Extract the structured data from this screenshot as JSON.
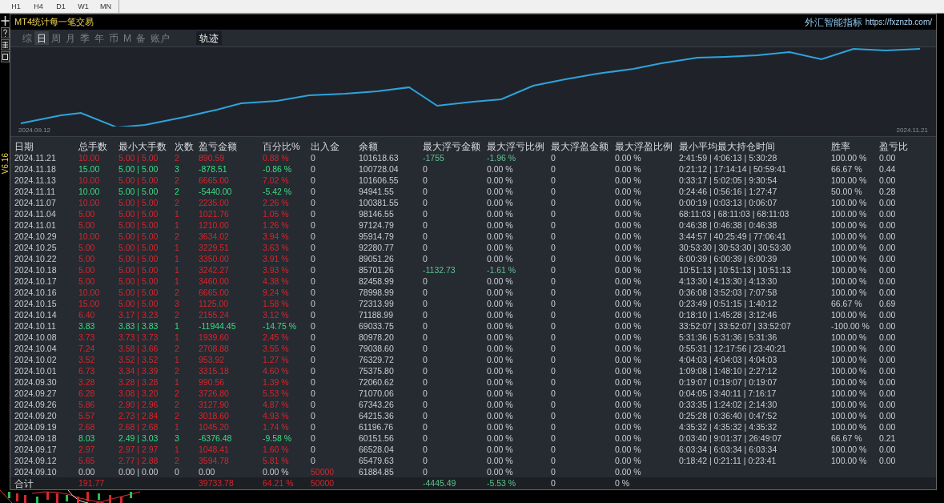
{
  "toolbar": {
    "timeframes": [
      "H1",
      "H4",
      "D1",
      "W1",
      "MN"
    ]
  },
  "sidebar": {
    "version": "V6.16"
  },
  "panel": {
    "title": "MT4统计每一笔交易",
    "brand": "外汇智能指标",
    "url": "https://fxznzb.com/"
  },
  "tabs": [
    {
      "label": "综",
      "selected": false
    },
    {
      "label": "日",
      "selected": true
    },
    {
      "label": "周",
      "selected": false
    },
    {
      "label": "月",
      "selected": false
    },
    {
      "label": "季",
      "selected": false
    },
    {
      "label": "年",
      "selected": false
    },
    {
      "label": "币",
      "selected": false
    },
    {
      "label": "M",
      "selected": false
    },
    {
      "label": "备",
      "selected": false
    },
    {
      "label": "账户",
      "selected": false
    }
  ],
  "track_button": {
    "label": "轨迹"
  },
  "chart": {
    "start_label": "2024.09.12",
    "end_label": "2024.11.21"
  },
  "table": {
    "columns": [
      "日期",
      "总手数",
      "最小大手数",
      "次数",
      "盈亏金额",
      "百分比%",
      "出入金",
      "余额",
      "最大浮亏金额",
      "最大浮亏比例",
      "最大浮盈金额",
      "最大浮盈比例",
      "最小平均最大持仓时间",
      "胜率",
      "盈亏比"
    ],
    "rows": [
      {
        "kind": "profit",
        "float_loss": true,
        "cells": [
          "2024.11.21",
          "10.00",
          "5.00 | 5.00",
          "2",
          "890.59",
          "0.88 %",
          "0",
          "101618.63",
          "-1755",
          "-1.96 %",
          "0",
          "0.00 %",
          "2:41:59 | 4:06:13 | 5:30:28",
          "100.00 %",
          "0.00"
        ]
      },
      {
        "kind": "loss",
        "float_loss": false,
        "cells": [
          "2024.11.18",
          "15.00",
          "5.00 | 5.00",
          "3",
          "-878.51",
          "-0.86 %",
          "0",
          "100728.04",
          "0",
          "0.00 %",
          "0",
          "0.00 %",
          "0:21:12 | 17:14:14 | 50:59:41",
          "66.67 %",
          "0.44"
        ]
      },
      {
        "kind": "profit",
        "float_loss": false,
        "cells": [
          "2024.11.13",
          "10.00",
          "5.00 | 5.00",
          "2",
          "6665.00",
          "7.02 %",
          "0",
          "101606.55",
          "0",
          "0.00 %",
          "0",
          "0.00 %",
          "0:33:17 | 5:02:05 | 9:30:54",
          "100.00 %",
          "0.00"
        ]
      },
      {
        "kind": "loss",
        "float_loss": false,
        "cells": [
          "2024.11.11",
          "10.00",
          "5.00 | 5.00",
          "2",
          "-5440.00",
          "-5.42 %",
          "0",
          "94941.55",
          "0",
          "0.00 %",
          "0",
          "0.00 %",
          "0:24:46 | 0:56:16 | 1:27:47",
          "50.00 %",
          "0.28"
        ]
      },
      {
        "kind": "profit",
        "float_loss": false,
        "cells": [
          "2024.11.07",
          "10.00",
          "5.00 | 5.00",
          "2",
          "2235.00",
          "2.26 %",
          "0",
          "100381.55",
          "0",
          "0.00 %",
          "0",
          "0.00 %",
          "0:00:19 | 0:03:13 | 0:06:07",
          "100.00 %",
          "0.00"
        ]
      },
      {
        "kind": "profit",
        "float_loss": false,
        "cells": [
          "2024.11.04",
          "5.00",
          "5.00 | 5.00",
          "1",
          "1021.76",
          "1.05 %",
          "0",
          "98146.55",
          "0",
          "0.00 %",
          "0",
          "0.00 %",
          "68:11:03 | 68:11:03 | 68:11:03",
          "100.00 %",
          "0.00"
        ]
      },
      {
        "kind": "profit",
        "float_loss": false,
        "cells": [
          "2024.11.01",
          "5.00",
          "5.00 | 5.00",
          "1",
          "1210.00",
          "1.26 %",
          "0",
          "97124.79",
          "0",
          "0.00 %",
          "0",
          "0.00 %",
          "0:46:38 | 0:46:38 | 0:46:38",
          "100.00 %",
          "0.00"
        ]
      },
      {
        "kind": "profit",
        "float_loss": false,
        "cells": [
          "2024.10.29",
          "10.00",
          "5.00 | 5.00",
          "2",
          "3634.02",
          "3.94 %",
          "0",
          "95914.79",
          "0",
          "0.00 %",
          "0",
          "0.00 %",
          "3:44:57 | 40:25:49 | 77:06:41",
          "100.00 %",
          "0.00"
        ]
      },
      {
        "kind": "profit",
        "float_loss": false,
        "cells": [
          "2024.10.25",
          "5.00",
          "5.00 | 5.00",
          "1",
          "3229.51",
          "3.63 %",
          "0",
          "92280.77",
          "0",
          "0.00 %",
          "0",
          "0.00 %",
          "30:53:30 | 30:53:30 | 30:53:30",
          "100.00 %",
          "0.00"
        ]
      },
      {
        "kind": "profit",
        "float_loss": false,
        "cells": [
          "2024.10.22",
          "5.00",
          "5.00 | 5.00",
          "1",
          "3350.00",
          "3.91 %",
          "0",
          "89051.26",
          "0",
          "0.00 %",
          "0",
          "0.00 %",
          "6:00:39 | 6:00:39 | 6:00:39",
          "100.00 %",
          "0.00"
        ]
      },
      {
        "kind": "profit",
        "float_loss": true,
        "cells": [
          "2024.10.18",
          "5.00",
          "5.00 | 5.00",
          "1",
          "3242.27",
          "3.93 %",
          "0",
          "85701.26",
          "-1132.73",
          "-1.61 %",
          "0",
          "0.00 %",
          "10:51:13 | 10:51:13 | 10:51:13",
          "100.00 %",
          "0.00"
        ]
      },
      {
        "kind": "profit",
        "float_loss": false,
        "cells": [
          "2024.10.17",
          "5.00",
          "5.00 | 5.00",
          "1",
          "3460.00",
          "4.38 %",
          "0",
          "82458.99",
          "0",
          "0.00 %",
          "0",
          "0.00 %",
          "4:13:30 | 4:13:30 | 4:13:30",
          "100.00 %",
          "0.00"
        ]
      },
      {
        "kind": "profit",
        "float_loss": false,
        "cells": [
          "2024.10.16",
          "10.00",
          "5.00 | 5.00",
          "2",
          "6665.00",
          "9.24 %",
          "0",
          "78998.99",
          "0",
          "0.00 %",
          "0",
          "0.00 %",
          "0:36:08 | 3:52:03 | 7:07:58",
          "100.00 %",
          "0.00"
        ]
      },
      {
        "kind": "profit",
        "float_loss": false,
        "cells": [
          "2024.10.15",
          "15.00",
          "5.00 | 5.00",
          "3",
          "1125.00",
          "1.58 %",
          "0",
          "72313.99",
          "0",
          "0.00 %",
          "0",
          "0.00 %",
          "0:23:49 | 0:51:15 | 1:40:12",
          "66.67 %",
          "0.69"
        ]
      },
      {
        "kind": "profit",
        "float_loss": false,
        "cells": [
          "2024.10.14",
          "6.40",
          "3.17 | 3.23",
          "2",
          "2155.24",
          "3.12 %",
          "0",
          "71188.99",
          "0",
          "0.00 %",
          "0",
          "0.00 %",
          "0:18:10 | 1:45:28 | 3:12:46",
          "100.00 %",
          "0.00"
        ]
      },
      {
        "kind": "loss",
        "float_loss": false,
        "cells": [
          "2024.10.11",
          "3.83",
          "3.83 | 3.83",
          "1",
          "-11944.45",
          "-14.75 %",
          "0",
          "69033.75",
          "0",
          "0.00 %",
          "0",
          "0.00 %",
          "33:52:07 | 33:52:07 | 33:52:07",
          "-100.00 %",
          "0.00"
        ]
      },
      {
        "kind": "profit",
        "float_loss": false,
        "cells": [
          "2024.10.08",
          "3.73",
          "3.73 | 3.73",
          "1",
          "1939.60",
          "2.45 %",
          "0",
          "80978.20",
          "0",
          "0.00 %",
          "0",
          "0.00 %",
          "5:31:36 | 5:31:36 | 5:31:36",
          "100.00 %",
          "0.00"
        ]
      },
      {
        "kind": "profit",
        "float_loss": false,
        "cells": [
          "2024.10.04",
          "7.24",
          "3.58 | 3.66",
          "2",
          "2708.88",
          "3.55 %",
          "0",
          "79038.60",
          "0",
          "0.00 %",
          "0",
          "0.00 %",
          "0:55:31 | 12:17:56 | 23:40:21",
          "100.00 %",
          "0.00"
        ]
      },
      {
        "kind": "profit",
        "float_loss": false,
        "cells": [
          "2024.10.02",
          "3.52",
          "3.52 | 3.52",
          "1",
          "953.92",
          "1.27 %",
          "0",
          "76329.72",
          "0",
          "0.00 %",
          "0",
          "0.00 %",
          "4:04:03 | 4:04:03 | 4:04:03",
          "100.00 %",
          "0.00"
        ]
      },
      {
        "kind": "profit",
        "float_loss": false,
        "cells": [
          "2024.10.01",
          "6.73",
          "3.34 | 3.39",
          "2",
          "3315.18",
          "4.60 %",
          "0",
          "75375.80",
          "0",
          "0.00 %",
          "0",
          "0.00 %",
          "1:09:08 | 1:48:10 | 2:27:12",
          "100.00 %",
          "0.00"
        ]
      },
      {
        "kind": "profit",
        "float_loss": false,
        "cells": [
          "2024.09.30",
          "3.28",
          "3.28 | 3.28",
          "1",
          "990.56",
          "1.39 %",
          "0",
          "72060.62",
          "0",
          "0.00 %",
          "0",
          "0.00 %",
          "0:19:07 | 0:19:07 | 0:19:07",
          "100.00 %",
          "0.00"
        ]
      },
      {
        "kind": "profit",
        "float_loss": false,
        "cells": [
          "2024.09.27",
          "6.28",
          "3.08 | 3.20",
          "2",
          "3726.80",
          "5.53 %",
          "0",
          "71070.06",
          "0",
          "0.00 %",
          "0",
          "0.00 %",
          "0:04:05 | 3:40:11 | 7:16:17",
          "100.00 %",
          "0.00"
        ]
      },
      {
        "kind": "profit",
        "float_loss": false,
        "cells": [
          "2024.09.26",
          "5.86",
          "2.90 | 2.96",
          "2",
          "3127.90",
          "4.87 %",
          "0",
          "67343.26",
          "0",
          "0.00 %",
          "0",
          "0.00 %",
          "0:33:35 | 1:24:02 | 2:14:30",
          "100.00 %",
          "0.00"
        ]
      },
      {
        "kind": "profit",
        "float_loss": false,
        "cells": [
          "2024.09.20",
          "5.57",
          "2.73 | 2.84",
          "2",
          "3018.60",
          "4.93 %",
          "0",
          "64215.36",
          "0",
          "0.00 %",
          "0",
          "0.00 %",
          "0:25:28 | 0:36:40 | 0:47:52",
          "100.00 %",
          "0.00"
        ]
      },
      {
        "kind": "profit",
        "float_loss": false,
        "cells": [
          "2024.09.19",
          "2.68",
          "2.68 | 2.68",
          "1",
          "1045.20",
          "1.74 %",
          "0",
          "61196.76",
          "0",
          "0.00 %",
          "0",
          "0.00 %",
          "4:35:32 | 4:35:32 | 4:35:32",
          "100.00 %",
          "0.00"
        ]
      },
      {
        "kind": "loss",
        "float_loss": false,
        "cells": [
          "2024.09.18",
          "8.03",
          "2.49 | 3.03",
          "3",
          "-6376.48",
          "-9.58 %",
          "0",
          "60151.56",
          "0",
          "0.00 %",
          "0",
          "0.00 %",
          "0:03:40 | 9:01:37 | 26:49:07",
          "66.67 %",
          "0.21"
        ]
      },
      {
        "kind": "profit",
        "float_loss": false,
        "cells": [
          "2024.09.17",
          "2.97",
          "2.97 | 2.97",
          "1",
          "1048.41",
          "1.60 %",
          "0",
          "66528.04",
          "0",
          "0.00 %",
          "0",
          "0.00 %",
          "6:03:34 | 6:03:34 | 6:03:34",
          "100.00 %",
          "0.00"
        ]
      },
      {
        "kind": "profit",
        "float_loss": false,
        "cells": [
          "2024.09.12",
          "5.65",
          "2.77 | 2.88",
          "2",
          "3594.78",
          "5.81 %",
          "0",
          "65479.63",
          "0",
          "0.00 %",
          "0",
          "0.00 %",
          "0:18:42 | 0:21:11 | 0:23:41",
          "100.00 %",
          "0.00"
        ]
      },
      {
        "kind": "deposit",
        "float_loss": false,
        "cells": [
          "2024.09.10",
          "0.00",
          "0.00 | 0.00",
          "0",
          "0.00",
          "0.00 %",
          "50000",
          "61884.85",
          "0",
          "0.00 %",
          "0",
          "0.00 %"
        ]
      }
    ],
    "total": {
      "label": "合计",
      "lots": "191.77",
      "profit": "39733.78",
      "percent": "64.21 %",
      "deposit": "50000",
      "max_float_loss": "-4445.49",
      "max_float_loss_pct": "-5.53 %",
      "max_float_profit": "0",
      "max_float_profit_pct": "0 %"
    }
  }
}
